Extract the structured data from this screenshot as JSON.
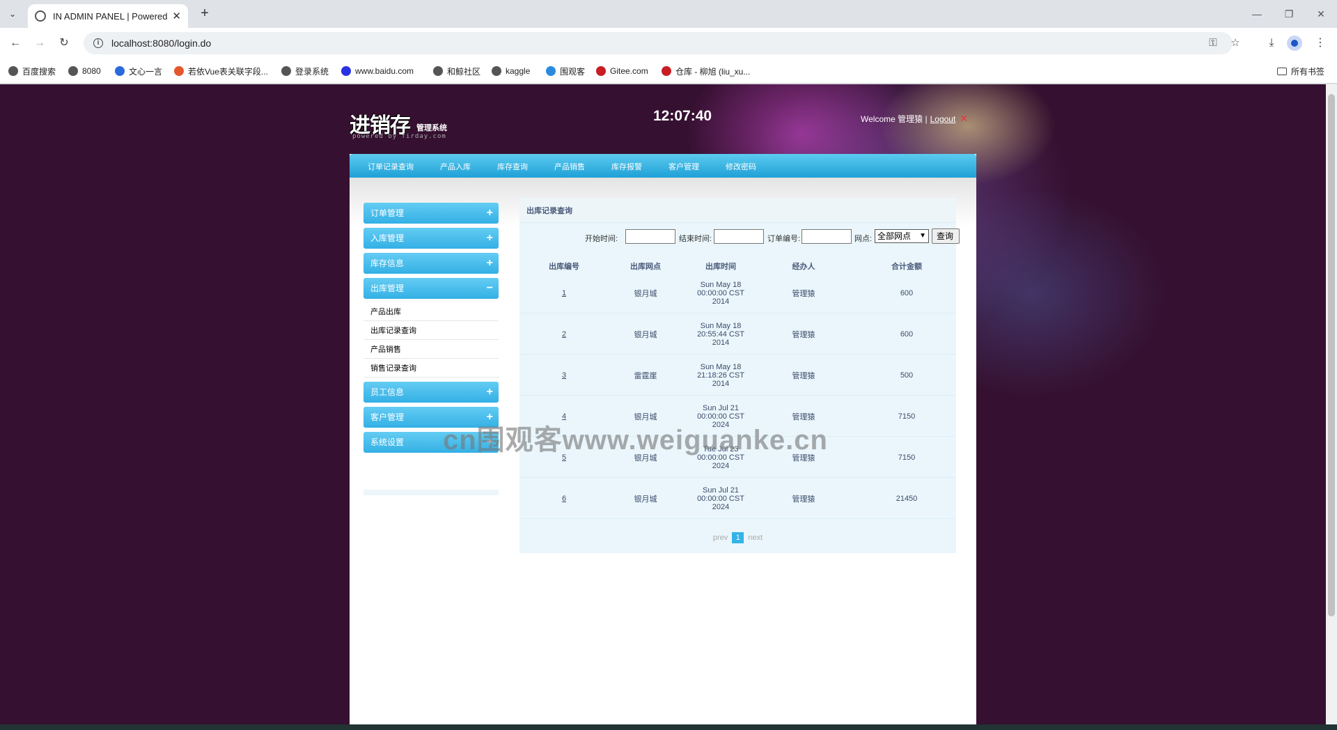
{
  "browser": {
    "tab_title": "IN ADMIN PANEL | Powered",
    "url": "localhost:8080/login.do",
    "bookmarks": [
      {
        "label": "百度搜索",
        "icon": "globe-icon"
      },
      {
        "label": "8080",
        "icon": "globe-icon"
      },
      {
        "label": "文心一言",
        "icon": "wenxin-icon"
      },
      {
        "label": "若依Vue表关联字段...",
        "icon": "jianshu-icon"
      },
      {
        "label": "登录系统",
        "icon": "globe-icon"
      },
      {
        "label": "www.baidu.com",
        "icon": "baidu-paw-icon"
      },
      {
        "label": "和鲸社区",
        "icon": "globe-icon"
      },
      {
        "label": "kaggle",
        "icon": "globe-icon"
      },
      {
        "label": "围观客",
        "icon": "weiguanke-icon"
      },
      {
        "label": "Gitee.com",
        "icon": "gitee-icon"
      },
      {
        "label": "仓库 - 柳旭 (liu_xu...",
        "icon": "gitee-icon"
      }
    ],
    "all_bookmarks": "所有书签"
  },
  "header": {
    "logo_big": "进销存",
    "logo_small": "管理系统",
    "logo_powered": "powered  by  firday.com",
    "clock": "12:07:40",
    "welcome": "Welcome 管理猿 |",
    "logout": "Logout"
  },
  "topnav": [
    "订单记录查询",
    "产品入库",
    "库存查询",
    "产品销售",
    "库存报警",
    "客户管理",
    "修改密码"
  ],
  "sidebar": {
    "sections": [
      {
        "label": "订单管理",
        "sign": "+"
      },
      {
        "label": "入库管理",
        "sign": "+"
      },
      {
        "label": "库存信息",
        "sign": "+"
      },
      {
        "label": "出库管理",
        "sign": "−"
      }
    ],
    "sub_items": [
      "产品出库",
      "出库记录查询",
      "产品销售",
      "销售记录查询"
    ],
    "sections_after": [
      {
        "label": "员工信息",
        "sign": "+"
      },
      {
        "label": "客户管理",
        "sign": "+"
      },
      {
        "label": "系统设置",
        "sign": "+"
      }
    ]
  },
  "panel": {
    "title": "出库记录查询",
    "filter": {
      "start_label": "开始时间:",
      "end_label": "结束时间:",
      "order_label": "订单编号:",
      "site_label": "网点:",
      "site_selected": "全部网点",
      "query_button": "查询"
    },
    "columns": [
      "出库编号",
      "出库网点",
      "出库时间",
      "经办人",
      "合计金额"
    ],
    "rows": [
      {
        "id": "1",
        "site": "银月城",
        "time": "Sun May 18 00:00:00 CST 2014",
        "agent": "管理猿",
        "amount": "600"
      },
      {
        "id": "2",
        "site": "银月城",
        "time": "Sun May 18 20:55:44 CST 2014",
        "agent": "管理猿",
        "amount": "600"
      },
      {
        "id": "3",
        "site": "雷霆崖",
        "time": "Sun May 18 21:18:26 CST 2014",
        "agent": "管理猿",
        "amount": "500"
      },
      {
        "id": "4",
        "site": "银月城",
        "time": "Sun Jul 21 00:00:00 CST 2024",
        "agent": "管理猿",
        "amount": "7150"
      },
      {
        "id": "5",
        "site": "银月城",
        "time": "Tue Jul 23 00:00:00 CST 2024",
        "agent": "管理猿",
        "amount": "7150"
      },
      {
        "id": "6",
        "site": "银月城",
        "time": "Sun Jul 21 00:00:00 CST 2024",
        "agent": "管理猿",
        "amount": "21450"
      }
    ],
    "pager": {
      "prev": "prev",
      "current": "1",
      "next": "next"
    }
  },
  "watermark": "cn围观客www.weiguanke.cn",
  "colors": {
    "accent": "#33b3e6",
    "page_bg": "#351030",
    "panel_bg": "#eaf6fb"
  }
}
